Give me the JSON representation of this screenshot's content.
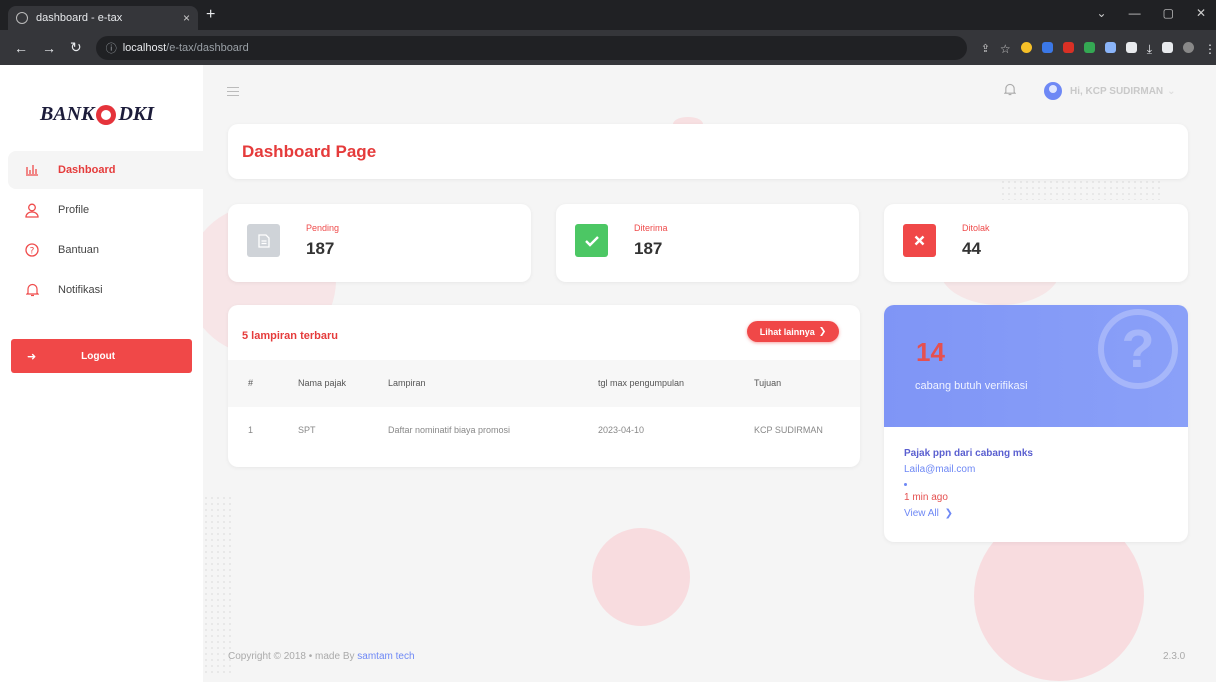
{
  "browser": {
    "tab_title": "dashboard - e-tax",
    "tab_close": "×",
    "new_tab": "+",
    "url_host": "localhost",
    "url_path": "/e-tax/dashboard"
  },
  "sidebar": {
    "logo_left": "BANK",
    "logo_right": "DKI",
    "items": [
      {
        "label": "Dashboard",
        "icon": "bar-chart-icon",
        "active": true
      },
      {
        "label": "Profile",
        "icon": "user-icon"
      },
      {
        "label": "Bantuan",
        "icon": "help-icon"
      },
      {
        "label": "Notifikasi",
        "icon": "bell-icon"
      }
    ],
    "logout_label": "Logout"
  },
  "header": {
    "user_label": "Hi, KCP SUDIRMAN"
  },
  "page_title": "Dashboard Page",
  "stats": [
    {
      "label": "Pending",
      "value": "187",
      "color": "#cfd3d8",
      "icon": "document-icon"
    },
    {
      "label": "Diterima",
      "value": "187",
      "color": "#4cc764",
      "icon": "check-icon"
    },
    {
      "label": "Ditolak",
      "value": "44",
      "color": "#f04848",
      "icon": "x-icon"
    }
  ],
  "attachments": {
    "title": "5 lampiran terbaru",
    "more_label": "Lihat lainnya",
    "columns": [
      "#",
      "Nama pajak",
      "Lampiran",
      "tgl max pengumpulan",
      "Tujuan"
    ],
    "rows": [
      [
        "1",
        "SPT",
        "Daftar nominatif biaya promosi",
        "2023-04-10",
        "KCP SUDIRMAN"
      ]
    ]
  },
  "verification": {
    "count": "14",
    "text": "cabang butuh verifikasi",
    "notice_title": "Pajak ppn dari cabang mks",
    "notice_email": "Laila@mail.com",
    "notice_time": "1 min ago",
    "view_all": "View All"
  },
  "footer": {
    "copyright": "Copyright © 2018 • made By ",
    "author": "samtam tech",
    "version": "2.3.0"
  },
  "colors": {
    "accent": "#e53b3b",
    "blue": "#6e88f5"
  }
}
